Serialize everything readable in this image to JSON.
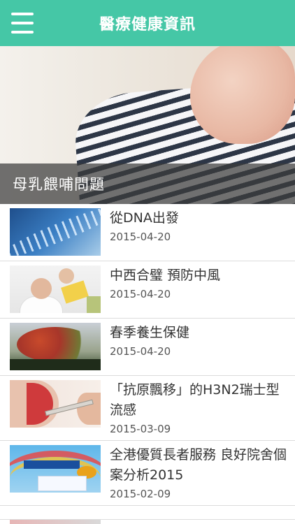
{
  "header": {
    "title": "醫療健康資訊",
    "background_color": "#45c7a6"
  },
  "hero": {
    "caption": "母乳餵哺問題"
  },
  "articles": [
    {
      "title": "從DNA出發",
      "date": "2015-04-20"
    },
    {
      "title": "中西合璧 預防中風",
      "date": "2015-04-20"
    },
    {
      "title": "春季養生保健",
      "date": "2015-04-20"
    },
    {
      "title": "「抗原飄移」的H3N2瑞士型流感",
      "date": "2015-03-09"
    },
    {
      "title": "全港優質長者服務 良好院舍個案分析2015",
      "date": "2015-02-09"
    }
  ]
}
